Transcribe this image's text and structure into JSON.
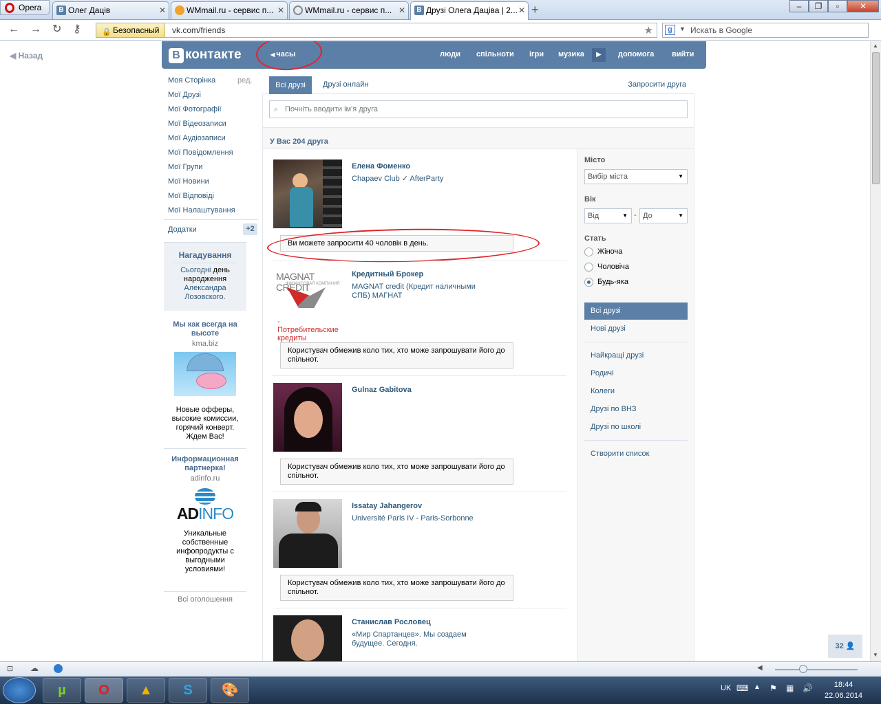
{
  "browser": {
    "opera_label": "Opera",
    "tabs": [
      {
        "label": "Олег Даців",
        "icon": "vk-icon"
      },
      {
        "label": "WMmail.ru - сервис п...",
        "icon": "wmmail-icon"
      },
      {
        "label": "WMmail.ru - сервис п...",
        "icon": "loading-icon"
      },
      {
        "label": "Друзі Олега Даціва | 2...",
        "icon": "vk-icon"
      }
    ],
    "secure_label": "Безопасный",
    "url": "vk.com/friends",
    "search_placeholder": "Искать в Google"
  },
  "page": {
    "back_label": "Назад",
    "logo": "контакте",
    "logo_letter": "В",
    "hours_label": "часы",
    "top_nav": [
      "люди",
      "спільноти",
      "ігри",
      "музика",
      "допомога",
      "вийти"
    ],
    "left_menu": [
      "Моя Сторінка",
      "Мої Друзі",
      "Мої Фотографії",
      "Мої Відеозаписи",
      "Мої Аудіозаписи",
      "Мої Повідомлення",
      "Мої Групи",
      "Мої Новини",
      "Мої Відповіді",
      "Мої Налаштування"
    ],
    "edit_label": "ред.",
    "apps_label": "Додатки",
    "apps_badge": "+2",
    "reminder": {
      "title": "Нагадування",
      "line1_link": "Сьогодні",
      "line1_text": "день",
      "line2": "народження",
      "name1": "Александра",
      "name2": "Лозовского."
    },
    "ads": [
      {
        "title1": "Мы как всегда на",
        "title2": "высоте",
        "domain": "kma.biz",
        "t1": "Новые офферы,",
        "t2": "высокие комиссии,",
        "t3": "горячий конверт.",
        "t4": "Ждем Вас!"
      },
      {
        "title1": "Информационная",
        "title2": "партнерка!",
        "domain": "adinfo.ru",
        "logo_a": "AD",
        "logo_b": "INFO",
        "t1": "Уникальные",
        "t2": "собственные",
        "t3": "инфопродукты с",
        "t4": "выгодными",
        "t5": "условиями!"
      }
    ],
    "all_ads": "Всі оголошення",
    "tabs": [
      "Всі друзі",
      "Друзі онлайн"
    ],
    "invite_link": "Запросити друга",
    "search_placeholder": "Почніть вводити ім'я друга",
    "friends_count": "У Вас 204 друга",
    "friends": [
      {
        "name": "Елена Фоменко",
        "sub": "Chapaev Club ✓ AfterParty",
        "notice": "Ви можете запросити 40 чоловік в день."
      },
      {
        "name": "Кредитный Брокер",
        "sub": "MAGNAT credit (Кредит наличными СПБ) МАГНАТ",
        "logo_text": "MAGNAT CREDIT",
        "logo_sub": "ФИНАНСОВАЯ КОМПАНИЯ",
        "logo_caption": "- Потребительские кредиты",
        "notice": "Користувач обмежив коло тих, хто може запрошувати його до спільнот."
      },
      {
        "name": "Gulnaz Gabitova",
        "sub": "",
        "notice": "Користувач обмежив коло тих, хто може запрошувати його до спільнот."
      },
      {
        "name": "Issatay Jahangerov",
        "sub": "Université Paris IV - Paris-Sorbonne",
        "notice": "Користувач обмежив коло тих, хто може запрошувати його до спільнот."
      },
      {
        "name": "Станислав Рословец",
        "sub": "«Мир Спартанцев». Мы создаем будущее. Сегодня.",
        "notice": ""
      }
    ],
    "filters": {
      "city_label": "Місто",
      "city_value": "Вибір міста",
      "age_label": "Вік",
      "age_from": "Від",
      "age_dash": "-",
      "age_to": "До",
      "sex_label": "Стать",
      "sex_options": [
        "Жіноча",
        "Чоловіча",
        "Будь-яка"
      ],
      "selected_sex": "Будь-яка"
    },
    "right_links": {
      "selected": "Всі друзі",
      "group1": [
        "Нові друзі"
      ],
      "group2": [
        "Найкращі друзі",
        "Родичі",
        "Колеги",
        "Друзі по ВНЗ",
        "Друзі по школі"
      ],
      "group3": [
        "Створити список"
      ]
    },
    "online_count": "32"
  },
  "taskbar": {
    "lang": "UK",
    "time": "18:44",
    "date": "22.06.2014"
  },
  "colors": {
    "vk_blue": "#5b7fa6",
    "link": "#2b587a",
    "annotation_red": "#e0242b"
  }
}
